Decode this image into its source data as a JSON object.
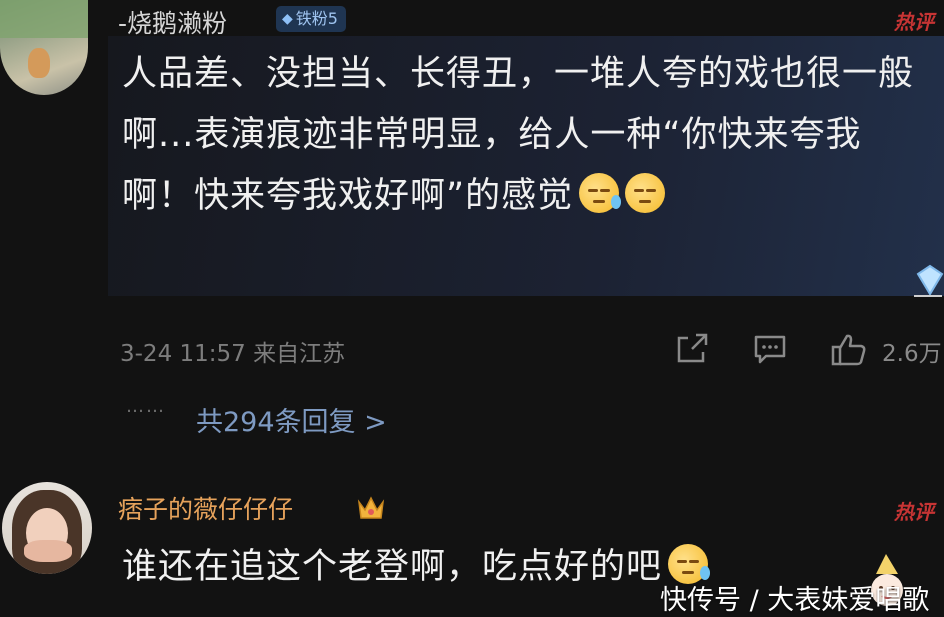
{
  "comment1": {
    "username": "-烧鹅濑粉",
    "badge_label": "铁粉5",
    "hot_label": "热评",
    "text": "人品差、没担当、长得丑，一堆人夸的戏也很一般啊...表演痕迹非常明显，给人一种“你快来夸我啊！快来夸我戏好啊”的感觉",
    "emojis": [
      "sweat-smile-emoji",
      "smirk-emoji"
    ],
    "date": "3-24 11:57",
    "location": "来自江苏",
    "like_count": "2.6万",
    "replies_dots": "……",
    "replies_label": "共294条回复 >"
  },
  "comment2": {
    "username": "痞子的薇仔仔仔",
    "hot_label": "热评",
    "text": "谁还在追这个老登啊，吃点好的吧",
    "emojis": [
      "sweat-smile-emoji"
    ]
  },
  "watermark": "快传号 / 大表妹爱唱歌",
  "icons": {
    "share": "share-icon",
    "comment": "comment-icon",
    "like": "thumbs-up-icon",
    "badge": "diamond-icon",
    "crown": "crown-icon"
  },
  "colors": {
    "background": "#121212",
    "username_gold": "#e6a25b",
    "reply_link": "#7e9ac2",
    "hot_red": "#c63434",
    "badge_bg": "#1f3552"
  }
}
